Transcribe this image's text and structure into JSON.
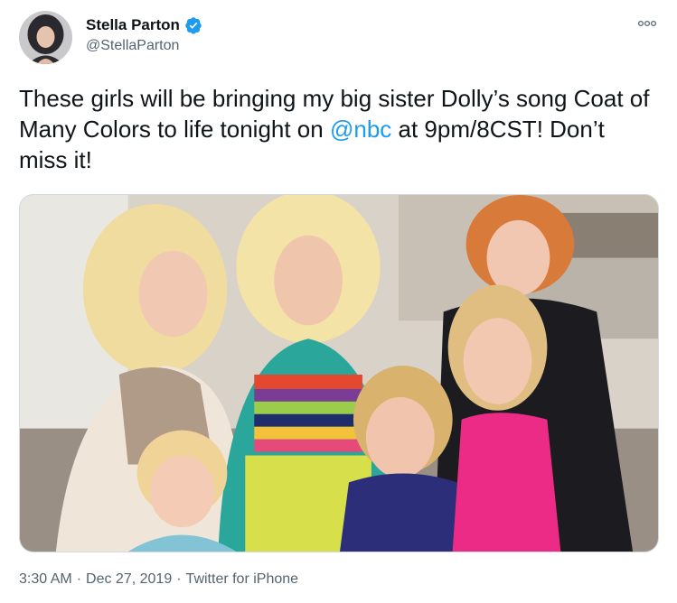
{
  "author": {
    "display_name": "Stella Parton",
    "handle": "@StellaParton",
    "verified": true
  },
  "tweet": {
    "text_before": "These girls will be bringing my big sister Dolly’s song Coat of Many Colors to life tonight on ",
    "mention": "@nbc",
    "text_after": " at 9pm/8CST! Don’t miss it!"
  },
  "meta": {
    "time": "3:30 AM",
    "separator": "·",
    "date": "Dec 27, 2019",
    "source": "Twitter for iPhone"
  },
  "icons": {
    "verified": "verified-badge-icon",
    "more": "more-options-icon"
  },
  "colors": {
    "accent": "#1d9bf0",
    "text": "#0f1419",
    "secondary_text": "#536471",
    "border": "#cfd9de"
  }
}
